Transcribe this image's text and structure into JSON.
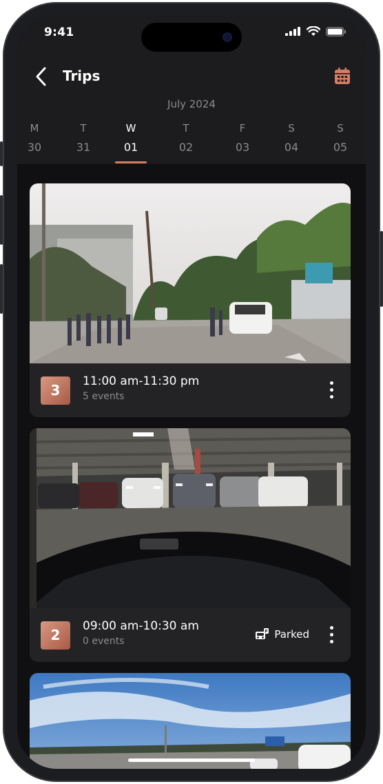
{
  "status_bar": {
    "time": "9:41"
  },
  "header": {
    "title": "Trips"
  },
  "calendar": {
    "month_label": "July 2024",
    "days": [
      {
        "letter": "M",
        "date": "30",
        "active": false
      },
      {
        "letter": "T",
        "date": "31",
        "active": false
      },
      {
        "letter": "W",
        "date": "01",
        "active": true
      },
      {
        "letter": "T",
        "date": "02",
        "active": false
      },
      {
        "letter": "F",
        "date": "03",
        "active": false
      },
      {
        "letter": "S",
        "date": "04",
        "active": false
      },
      {
        "letter": "S",
        "date": "05",
        "active": false
      }
    ]
  },
  "trips": [
    {
      "number": "3",
      "time_range": "11:00 am-11:30 pm",
      "events": "5 events",
      "status": ""
    },
    {
      "number": "2",
      "time_range": "09:00 am-10:30 am",
      "events": "0 events",
      "status": "Parked"
    }
  ],
  "colors": {
    "accent": "#d67e62",
    "background": "#101012",
    "card": "#232325"
  }
}
